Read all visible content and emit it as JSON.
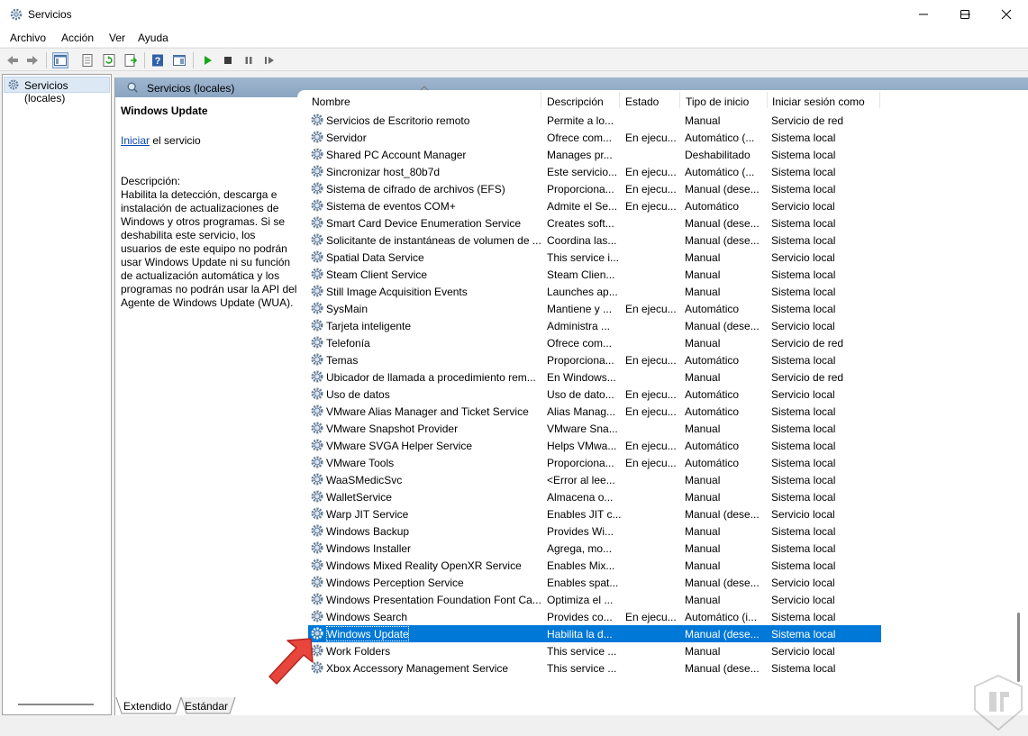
{
  "window": {
    "title": "Servicios",
    "minimize_icon": "minimize-icon",
    "maximize_icon": "maximize-icon",
    "close_icon": "close-icon"
  },
  "menu": [
    "Archivo",
    "Acción",
    "Ver",
    "Ayuda"
  ],
  "toolbar": {
    "icons": [
      "back-icon",
      "forward-icon",
      "show-hide-console-tree-icon",
      "properties-icon",
      "refresh-icon",
      "export-list-icon",
      "help-icon",
      "show-action-pane-icon",
      "play-icon",
      "stop-icon",
      "pause-icon",
      "restart-icon"
    ]
  },
  "tree": {
    "root_label": "Servicios (locales)"
  },
  "main_header": {
    "label": "Servicios (locales)"
  },
  "description": {
    "title": "Windows Update",
    "action_link": "Iniciar",
    "action_suffix": " el servicio",
    "label": "Descripción:",
    "text": "Habilita la detección, descarga e instalación de actualizaciones de Windows y otros programas. Si se deshabilita este servicio, los usuarios de este equipo no podrán usar Windows Update ni su función de actualización automática y los programas no podrán usar la API del Agente de Windows Update (WUA)."
  },
  "columns": [
    "Nombre",
    "Descripción",
    "Estado",
    "Tipo de inicio",
    "Iniciar sesión como"
  ],
  "rows": [
    {
      "name": "Servicios de Escritorio remoto",
      "desc": "Permite a lo...",
      "state": "",
      "start": "Manual",
      "logon": "Servicio de red"
    },
    {
      "name": "Servidor",
      "desc": "Ofrece com...",
      "state": "En ejecu...",
      "start": "Automático (...",
      "logon": "Sistema local"
    },
    {
      "name": "Shared PC Account Manager",
      "desc": "Manages pr...",
      "state": "",
      "start": "Deshabilitado",
      "logon": "Sistema local"
    },
    {
      "name": "Sincronizar host_80b7d",
      "desc": "Este servicio...",
      "state": "En ejecu...",
      "start": "Automático (...",
      "logon": "Sistema local"
    },
    {
      "name": "Sistema de cifrado de archivos (EFS)",
      "desc": "Proporciona...",
      "state": "En ejecu...",
      "start": "Manual (dese...",
      "logon": "Sistema local"
    },
    {
      "name": "Sistema de eventos COM+",
      "desc": "Admite el Se...",
      "state": "En ejecu...",
      "start": "Automático",
      "logon": "Servicio local"
    },
    {
      "name": "Smart Card Device Enumeration Service",
      "desc": "Creates soft...",
      "state": "",
      "start": "Manual (dese...",
      "logon": "Sistema local"
    },
    {
      "name": "Solicitante de instantáneas de volumen de ...",
      "desc": "Coordina las...",
      "state": "",
      "start": "Manual (dese...",
      "logon": "Sistema local"
    },
    {
      "name": "Spatial Data Service",
      "desc": "This service i...",
      "state": "",
      "start": "Manual",
      "logon": "Servicio local"
    },
    {
      "name": "Steam Client Service",
      "desc": "Steam Clien...",
      "state": "",
      "start": "Manual",
      "logon": "Sistema local"
    },
    {
      "name": "Still Image Acquisition Events",
      "desc": "Launches ap...",
      "state": "",
      "start": "Manual",
      "logon": "Sistema local"
    },
    {
      "name": "SysMain",
      "desc": "Mantiene y ...",
      "state": "En ejecu...",
      "start": "Automático",
      "logon": "Sistema local"
    },
    {
      "name": "Tarjeta inteligente",
      "desc": "Administra ...",
      "state": "",
      "start": "Manual (dese...",
      "logon": "Servicio local"
    },
    {
      "name": "Telefonía",
      "desc": "Ofrece com...",
      "state": "",
      "start": "Manual",
      "logon": "Servicio de red"
    },
    {
      "name": "Temas",
      "desc": "Proporciona...",
      "state": "En ejecu...",
      "start": "Automático",
      "logon": "Sistema local"
    },
    {
      "name": "Ubicador de llamada a procedimiento rem...",
      "desc": "En Windows...",
      "state": "",
      "start": "Manual",
      "logon": "Servicio de red"
    },
    {
      "name": "Uso de datos",
      "desc": "Uso de dato...",
      "state": "En ejecu...",
      "start": "Automático",
      "logon": "Servicio local"
    },
    {
      "name": "VMware Alias Manager and Ticket Service",
      "desc": "Alias Manag...",
      "state": "En ejecu...",
      "start": "Automático",
      "logon": "Sistema local"
    },
    {
      "name": "VMware Snapshot Provider",
      "desc": "VMware Sna...",
      "state": "",
      "start": "Manual",
      "logon": "Sistema local"
    },
    {
      "name": "VMware SVGA Helper Service",
      "desc": "Helps VMwa...",
      "state": "En ejecu...",
      "start": "Automático",
      "logon": "Sistema local"
    },
    {
      "name": "VMware Tools",
      "desc": "Proporciona...",
      "state": "En ejecu...",
      "start": "Automático",
      "logon": "Sistema local"
    },
    {
      "name": "WaaSMedicSvc",
      "desc": "<Error al lee...",
      "state": "",
      "start": "Manual",
      "logon": "Sistema local"
    },
    {
      "name": "WalletService",
      "desc": "Almacena o...",
      "state": "",
      "start": "Manual",
      "logon": "Sistema local"
    },
    {
      "name": "Warp JIT Service",
      "desc": "Enables JIT c...",
      "state": "",
      "start": "Manual (dese...",
      "logon": "Servicio local"
    },
    {
      "name": "Windows Backup",
      "desc": "Provides Wi...",
      "state": "",
      "start": "Manual",
      "logon": "Sistema local"
    },
    {
      "name": "Windows Installer",
      "desc": "Agrega, mo...",
      "state": "",
      "start": "Manual",
      "logon": "Sistema local"
    },
    {
      "name": "Windows Mixed Reality OpenXR Service",
      "desc": "Enables Mix...",
      "state": "",
      "start": "Manual",
      "logon": "Sistema local"
    },
    {
      "name": "Windows Perception Service",
      "desc": "Enables spat...",
      "state": "",
      "start": "Manual (dese...",
      "logon": "Servicio local"
    },
    {
      "name": "Windows Presentation Foundation Font Ca...",
      "desc": "Optimiza el ...",
      "state": "",
      "start": "Manual",
      "logon": "Servicio local"
    },
    {
      "name": "Windows Search",
      "desc": "Provides co...",
      "state": "En ejecu...",
      "start": "Automático (i...",
      "logon": "Sistema local"
    },
    {
      "name": "Windows Update",
      "desc": "Habilita la d...",
      "state": "",
      "start": "Manual (dese...",
      "logon": "Sistema local",
      "selected": true
    },
    {
      "name": "Work Folders",
      "desc": "This service ...",
      "state": "",
      "start": "Manual",
      "logon": "Servicio local"
    },
    {
      "name": "Xbox Accessory Management Service",
      "desc": "This service ...",
      "state": "",
      "start": "Manual (dese...",
      "logon": "Sistema local"
    }
  ],
  "tabs": [
    "Extendido",
    "Estándar"
  ],
  "colors": {
    "selection": "#0078d7",
    "header_band": "#9fb6cf",
    "arrow": "#e8453c",
    "play": "#1aa51a"
  }
}
